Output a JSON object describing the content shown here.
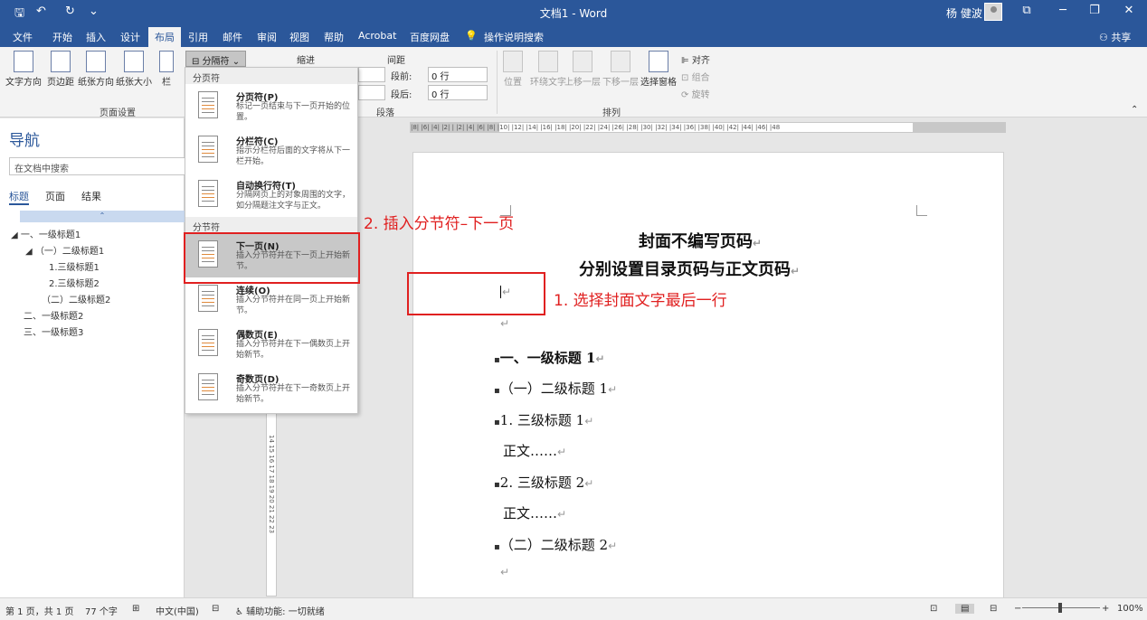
{
  "titlebar": {
    "quick_access": [
      "🖫",
      "↶",
      "↻",
      "⌄"
    ],
    "doc_title": "文档1 - Word",
    "user": "杨 健波",
    "win_controls": [
      "⧉",
      "─",
      "❐",
      "✕"
    ]
  },
  "tabs": [
    "文件",
    "开始",
    "插入",
    "设计",
    "布局",
    "引用",
    "邮件",
    "审阅",
    "视图",
    "帮助",
    "Acrobat",
    "百度网盘",
    "操作说明搜索"
  ],
  "active_tab": "布局",
  "share": "共享",
  "ribbon": {
    "page_setup": {
      "buttons": [
        "文字方向",
        "页边距",
        "纸张方向",
        "纸张大小",
        "栏"
      ],
      "group_label": "页面设置"
    },
    "breaks_button": "分隔符",
    "indent_label": "缩进",
    "spacing_label": "间距",
    "spacing_before_label": "段前:",
    "spacing_before_value": "0 行",
    "spacing_after_label": "段后:",
    "spacing_after_value": "0 行",
    "paragraph_group_label": "段落",
    "arrange": {
      "buttons": [
        "位置",
        "环绕文字",
        "上移一层",
        "下移一层",
        "选择窗格"
      ],
      "small": [
        "对齐",
        "组合",
        "旋转"
      ],
      "group_label": "排列"
    }
  },
  "breaks_menu": {
    "page_breaks_header": "分页符",
    "section_breaks_header": "分节符",
    "page_items": [
      {
        "title": "分页符(P)",
        "desc": "标记一页结束与下一页开始的位置。"
      },
      {
        "title": "分栏符(C)",
        "desc": "指示分栏符后面的文字将从下一栏开始。"
      },
      {
        "title": "自动换行符(T)",
        "desc": "分隔网页上的对象周围的文字，如分隔题注文字与正文。"
      }
    ],
    "section_items": [
      {
        "title": "下一页(N)",
        "desc": "插入分节符并在下一页上开始新节。"
      },
      {
        "title": "连续(O)",
        "desc": "插入分节符并在同一页上开始新节。"
      },
      {
        "title": "偶数页(E)",
        "desc": "插入分节符并在下一偶数页上开始新节。"
      },
      {
        "title": "奇数页(D)",
        "desc": "插入分节符并在下一奇数页上开始新节。"
      }
    ]
  },
  "nav": {
    "title": "导航",
    "search_placeholder": "在文档中搜索",
    "tabs": [
      "标题",
      "页面",
      "结果"
    ],
    "items": [
      "一、一级标题1",
      "（一）二级标题1",
      "1.三级标题1",
      "2.三级标题2",
      "（二）二级标题2",
      "二、一级标题2",
      "三、一级标题3"
    ]
  },
  "ruler_text": "|8|  |6|  |4|  |2|     |  |2|  |4|  |6|  |8|  |10|  |12|  |14|  |16|  |18|  |20|  |22|  |24|  |26|  |28|  |30|  |32|  |34|  |36|  |38|  |40|  |42|  |44|  |46|  |48",
  "vruler_text": "14 15 16 17 18 19 20 21 22 23",
  "document": {
    "title1": "封面不编写页码",
    "title2": "分别设置目录页码与正文页码",
    "lines": [
      "一、一级标题 1",
      "（一）二级标题 1",
      "1. 三级标题 1",
      "正文……",
      "2. 三级标题 2",
      "正文……",
      "（二）二级标题 2"
    ],
    "para_mark": "↵"
  },
  "annotations": {
    "step1": "1. 选择封面文字最后一行",
    "step2": "2. 插入分节符–下一页"
  },
  "colors": {
    "accent": "#2b579a",
    "annotation": "#e02020"
  },
  "statusbar": {
    "page": "第 1 页，共 1 页",
    "words": "77 个字",
    "language": "中文(中国)",
    "accessibility": "辅助功能: 一切就绪",
    "zoom_minus": "−",
    "zoom_plus": "+",
    "zoom": "100%"
  }
}
